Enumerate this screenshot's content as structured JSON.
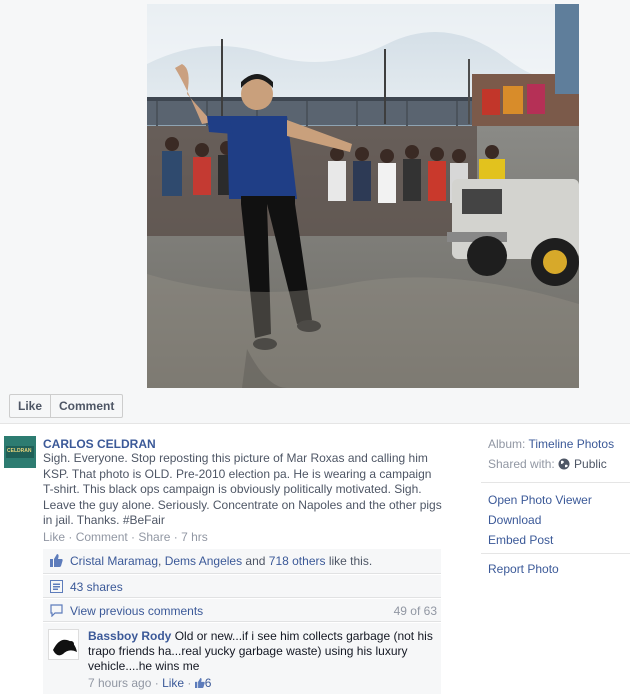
{
  "photo_viewer": {
    "like_label": "Like",
    "comment_label": "Comment"
  },
  "post": {
    "author": "CARLOS CELDRAN",
    "avatar_text": "CELDRAN",
    "caption": "Sigh. Everyone. Stop reposting this picture of Mar Roxas and calling him KSP. That photo is OLD. Pre-2010 election pa. He is wearing a campaign T-shirt. This black ops campaign is obviously politically motivated. Sigh. Leave the guy alone. Seriously. Concentrate on Napoles and the other pigs in jail. Thanks. #BeFair",
    "actions": {
      "like": "Like",
      "sep1": " · ",
      "comment": "Comment",
      "sep2": " · ",
      "share": "Share",
      "sep3": " · ",
      "time": "7 hrs"
    }
  },
  "ufi": {
    "likes": {
      "name1": "Cristal Maramag",
      "sep": ", ",
      "name2": "Dems Angeles",
      "and": " and ",
      "others": "718 others",
      "suffix": " like this."
    },
    "shares": "43 shares",
    "prev_comments": "View previous comments",
    "comment_count": "49 of 63"
  },
  "comment": {
    "author": "Bassboy Rody",
    "text": " Old or new...if i see him collects garbage (not his trapo friends ha...real yucky garbage waste) using his luxury vehicle....he wins me",
    "time": "7 hours ago",
    "sep": " · ",
    "like": "Like",
    "sep2": " · ",
    "like_count": "6"
  },
  "sidebar": {
    "album_label": "Album: ",
    "album_value": "Timeline Photos",
    "shared_label": "Shared with: ",
    "shared_value": "Public",
    "open_viewer": "Open Photo Viewer",
    "download": "Download",
    "embed": "Embed Post",
    "report": "Report Photo"
  },
  "colors": {
    "link": "#3b5998",
    "muted": "#9197a3",
    "ufi_bg": "#f6f7f8"
  }
}
